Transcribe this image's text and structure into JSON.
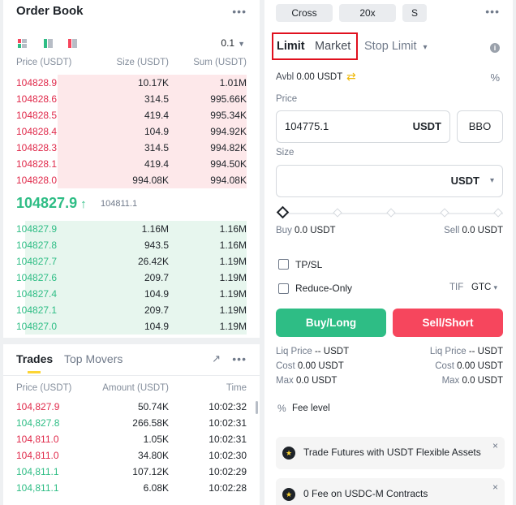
{
  "orderbook": {
    "title": "Order Book",
    "more": "•••",
    "tick_size": "0.1",
    "columns": [
      "Price (USDT)",
      "Size (USDT)",
      "Sum (USDT)"
    ],
    "asks": [
      {
        "price": "104828.9",
        "size": "10.17K",
        "sum": "1.01M",
        "depth": 0.82
      },
      {
        "price": "104828.6",
        "size": "314.5",
        "sum": "995.66K",
        "depth": 0.82
      },
      {
        "price": "104828.5",
        "size": "419.4",
        "sum": "995.34K",
        "depth": 0.82
      },
      {
        "price": "104828.4",
        "size": "104.9",
        "sum": "994.92K",
        "depth": 0.82
      },
      {
        "price": "104828.3",
        "size": "314.5",
        "sum": "994.82K",
        "depth": 0.82
      },
      {
        "price": "104828.1",
        "size": "419.4",
        "sum": "994.50K",
        "depth": 0.82
      },
      {
        "price": "104828.0",
        "size": "994.08K",
        "sum": "994.08K",
        "depth": 0.82
      }
    ],
    "last_price": "104827.9",
    "last_arrow": "↑",
    "mark_price": "104811.1",
    "bids": [
      {
        "price": "104827.9",
        "size": "1.16M",
        "sum": "1.16M",
        "depth": 0.96
      },
      {
        "price": "104827.8",
        "size": "943.5",
        "sum": "1.16M",
        "depth": 0.96
      },
      {
        "price": "104827.7",
        "size": "26.42K",
        "sum": "1.19M",
        "depth": 0.96
      },
      {
        "price": "104827.6",
        "size": "209.7",
        "sum": "1.19M",
        "depth": 0.96
      },
      {
        "price": "104827.4",
        "size": "104.9",
        "sum": "1.19M",
        "depth": 0.96
      },
      {
        "price": "104827.1",
        "size": "209.7",
        "sum": "1.19M",
        "depth": 0.96
      },
      {
        "price": "104827.0",
        "size": "104.9",
        "sum": "1.19M",
        "depth": 0.96
      }
    ]
  },
  "trades": {
    "tab_trades": "Trades",
    "tab_movers": "Top Movers",
    "expand_icon": "↗",
    "more": "•••",
    "columns": [
      "Price (USDT)",
      "Amount (USDT)",
      "Time"
    ],
    "rows": [
      {
        "price": "104,827.9",
        "amount": "50.74K",
        "time": "10:02:32",
        "side": "sell"
      },
      {
        "price": "104,827.8",
        "amount": "266.58K",
        "time": "10:02:31",
        "side": "buy"
      },
      {
        "price": "104,811.0",
        "amount": "1.05K",
        "time": "10:02:31",
        "side": "sell"
      },
      {
        "price": "104,811.0",
        "amount": "34.80K",
        "time": "10:02:30",
        "side": "sell"
      },
      {
        "price": "104,811.1",
        "amount": "107.12K",
        "time": "10:02:29",
        "side": "buy"
      },
      {
        "price": "104,811.1",
        "amount": "6.08K",
        "time": "10:02:28",
        "side": "buy"
      }
    ]
  },
  "form": {
    "margin_mode": "Cross",
    "leverage": "20x",
    "asset_mode": "S",
    "more": "•••",
    "tab_limit": "Limit",
    "tab_market": "Market",
    "tab_stop": "Stop Limit",
    "caret": "▾",
    "info": "i",
    "avbl_label": "Avbl",
    "avbl_value": "0.00 USDT",
    "transfer_icon": "⇄",
    "calc_icon": "%",
    "price_label": "Price",
    "price_value": "104775.1",
    "price_unit": "USDT",
    "bbo": "BBO",
    "size_label": "Size",
    "size_unit": "USDT",
    "slider_value": 0,
    "buy_label": "Buy",
    "buy_value": "0.0 USDT",
    "sell_label": "Sell",
    "sell_value": "0.0 USDT",
    "tpsl": "TP/SL",
    "reduce_only": "Reduce-Only",
    "tif_label": "TIF",
    "tif_value": "GTC",
    "buy_button": "Buy/Long",
    "sell_button": "Sell/Short",
    "liq_label": "Liq Price",
    "liq_buy": "-- USDT",
    "liq_sell": "-- USDT",
    "cost_label": "Cost",
    "cost_buy": "0.00 USDT",
    "cost_sell": "0.00 USDT",
    "max_label": "Max",
    "max_buy": "0.0 USDT",
    "max_sell": "0.0 USDT",
    "fee_icon": "%",
    "fee_level": "Fee level",
    "promo1": "Trade Futures with USDT Flexible Assets",
    "promo2": "0 Fee on USDC-M Contracts",
    "close": "×"
  },
  "colors": {
    "green": "#2ebd85",
    "red": "#f6465d",
    "ask_text": "#e0294a",
    "accent": "#fcd535",
    "highlight_box": "#e0101e"
  }
}
